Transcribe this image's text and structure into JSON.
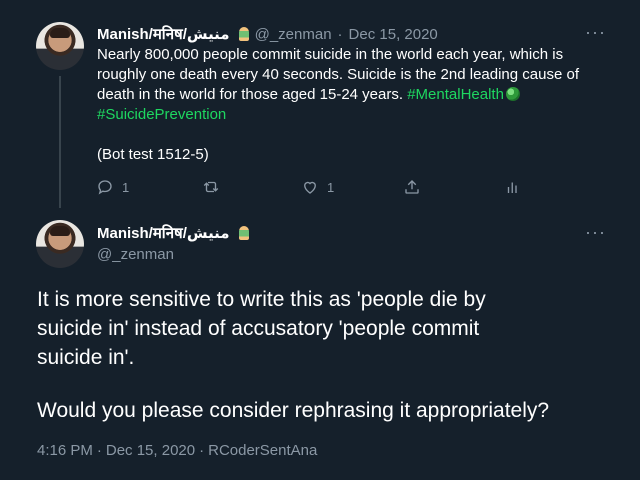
{
  "colors": {
    "background": "#15202b",
    "text_primary": "#ffffff",
    "text_secondary": "#8b98a5",
    "hashtag": "#1ed760",
    "divider": "#38444d"
  },
  "tweet1": {
    "author_name": "Manish/मनिष/منیش",
    "author_handle": "@_zenman",
    "separator": "·",
    "date": "Dec 15, 2020",
    "text_lines": [
      "Nearly 800,000 people commit suicide in the world each year, which is",
      "roughly one death every 40 seconds. Suicide is the 2nd leading cause of",
      "death in the world for those aged 15-24 years."
    ],
    "hashtag1": "#MentalHealth",
    "hashtag2": "#SuicidePrevention",
    "footer_text": "(Bot test 1512-5)",
    "reply_count": "1",
    "retweet_count": "",
    "like_count": "1",
    "icons": {
      "reply": "reply-icon",
      "retweet": "retweet-icon",
      "like": "heart-icon",
      "share": "share-icon",
      "analytics": "analytics-icon",
      "more": "more-icon",
      "emoji": "person-meditating-emoji-icon",
      "globe": "globe-emoji-icon"
    },
    "more_label": "···"
  },
  "tweet2": {
    "author_name": "Manish/मनिष/منیش",
    "author_handle": "@_zenman",
    "more_label": "···",
    "text_lines": [
      "It is more sensitive to write this as 'people die by",
      "suicide in' instead of accusatory 'people commit",
      "suicide in'."
    ],
    "text_line4": "Would you please consider rephrasing it appropriately?",
    "time": "4:16 PM",
    "date": "Dec 15, 2020",
    "source": "RCoderSentAna",
    "separator": "·"
  }
}
